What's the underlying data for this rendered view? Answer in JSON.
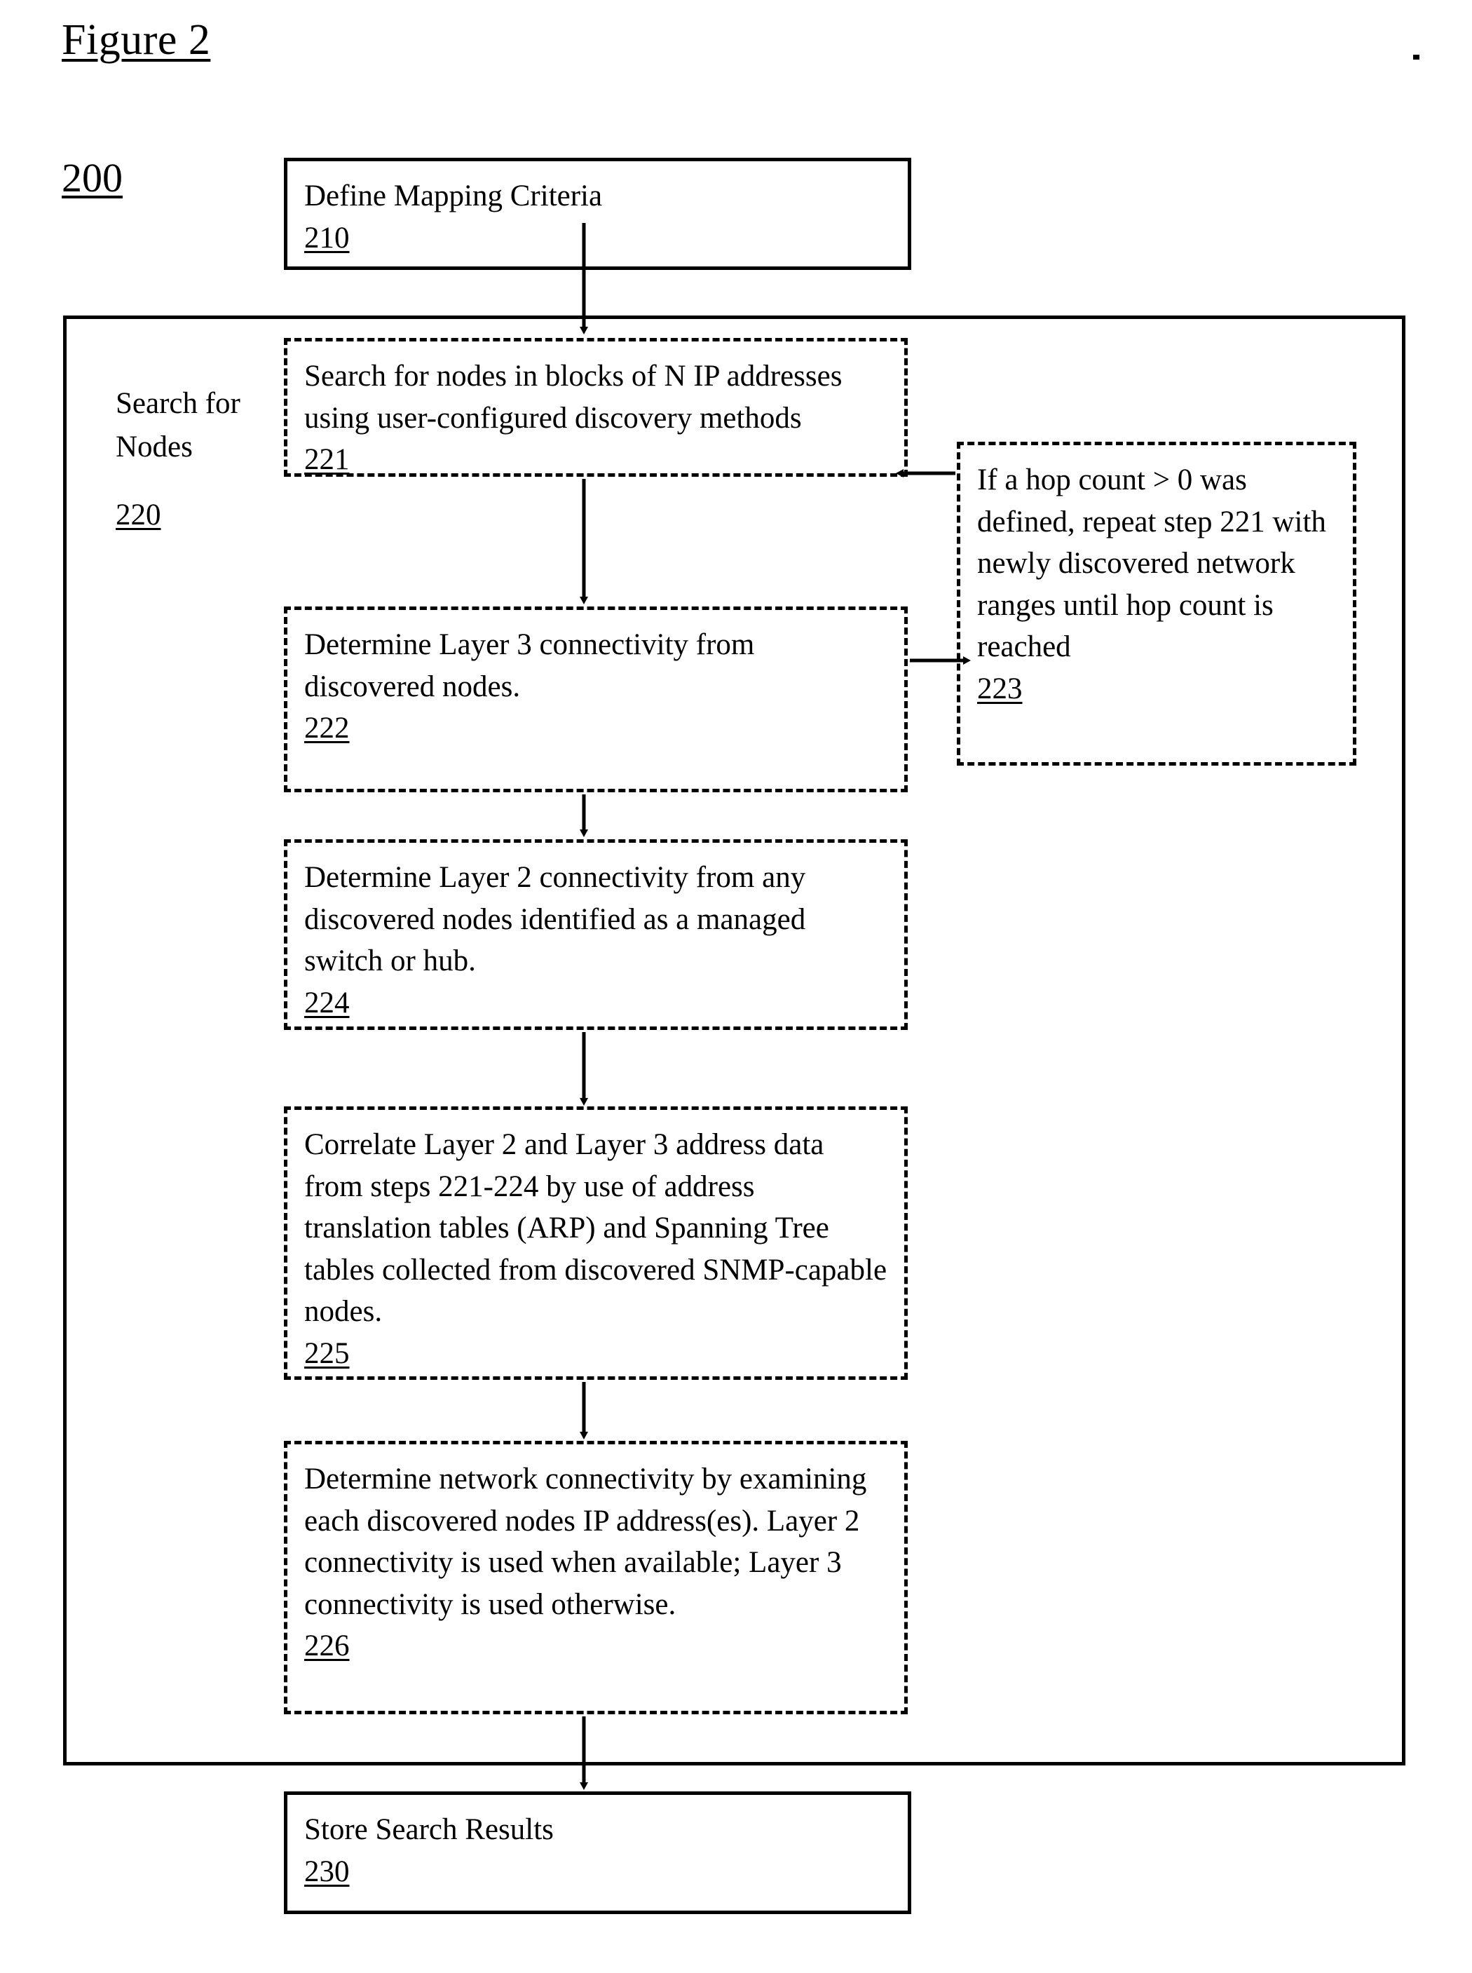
{
  "figure": {
    "title": "Figure 2",
    "reference_numeral": "200"
  },
  "group": {
    "label": "Search for\nNodes",
    "reference_numeral": "220"
  },
  "boxes": [
    {
      "id": "box-210",
      "style": "solid",
      "text": "Define Mapping Criteria",
      "ref": "210"
    },
    {
      "id": "box-221",
      "style": "dashed",
      "text": "Search for nodes in blocks of N IP addresses using user-configured discovery methods",
      "ref": "221"
    },
    {
      "id": "box-222",
      "style": "dashed",
      "text": "Determine Layer 3 connectivity from discovered nodes.",
      "ref": "222"
    },
    {
      "id": "box-223",
      "style": "dashed",
      "text": "If a hop count > 0 was defined, repeat step 221 with newly discovered network ranges until hop count is reached",
      "ref": "223"
    },
    {
      "id": "box-224",
      "style": "dashed",
      "text": "Determine Layer 2 connectivity from any discovered nodes identified as a managed switch or hub.",
      "ref": "224"
    },
    {
      "id": "box-225",
      "style": "dashed",
      "text": "Correlate Layer 2 and Layer 3 address data from steps 221-224 by use of address translation tables (ARP) and Spanning Tree tables collected from discovered SNMP-capable nodes.",
      "ref": "225"
    },
    {
      "id": "box-226",
      "style": "dashed",
      "text": "Determine network connectivity by examining each discovered nodes IP address(es). Layer 2 connectivity is used when available; Layer 3 connectivity is used otherwise.",
      "ref": "226"
    },
    {
      "id": "box-230",
      "style": "solid",
      "text": "Store Search Results",
      "ref": "230"
    }
  ],
  "connectors": [
    {
      "name": "arrow-210-to-221",
      "from": "210",
      "to": "221",
      "direction": "down"
    },
    {
      "name": "arrow-221-to-222",
      "from": "221",
      "to": "222",
      "direction": "down"
    },
    {
      "name": "arrow-222-to-223",
      "from": "222",
      "to": "223",
      "direction": "right"
    },
    {
      "name": "arrow-223-to-221",
      "from": "223",
      "to": "221",
      "direction": "left"
    },
    {
      "name": "arrow-222-to-224",
      "from": "222",
      "to": "224",
      "direction": "down"
    },
    {
      "name": "arrow-224-to-225",
      "from": "224",
      "to": "225",
      "direction": "down"
    },
    {
      "name": "arrow-225-to-226",
      "from": "225",
      "to": "226",
      "direction": "down"
    },
    {
      "name": "arrow-226-to-230",
      "from": "226",
      "to": "230",
      "direction": "down"
    }
  ],
  "colors": {
    "ink": "#000000",
    "paper": "#ffffff"
  }
}
